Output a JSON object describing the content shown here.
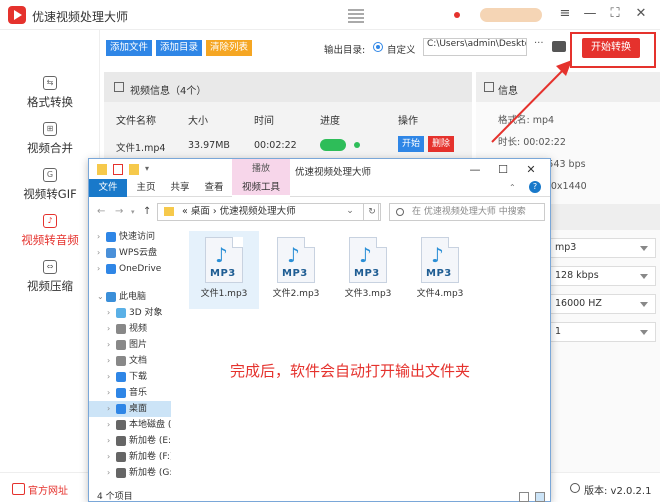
{
  "app": {
    "title": "优速视频处理大师",
    "sidebar": [
      {
        "icon": "format-icon",
        "glyph": "⇆",
        "label": "格式转换"
      },
      {
        "icon": "merge-icon",
        "glyph": "⊞",
        "label": "视频合并"
      },
      {
        "icon": "gif-icon",
        "glyph": "G",
        "label": "视频转GIF"
      },
      {
        "icon": "audio-icon",
        "glyph": "♪",
        "label": "视频转音频"
      },
      {
        "icon": "compress-icon",
        "glyph": "⇔",
        "label": "视频压缩"
      }
    ],
    "toolbar": {
      "add_file": "添加文件",
      "add_dir": "添加目录",
      "clear": "清除列表",
      "output_label": "输出目录:",
      "custom": "自定义",
      "path": "C:\\Users\\admin\\Deskto",
      "more": "···",
      "start": "开始转换"
    },
    "panel": {
      "title": "视频信息（4个）",
      "columns": [
        "文件名称",
        "大小",
        "时间",
        "进度",
        "操作"
      ],
      "row": {
        "name": "文件1.mp4",
        "size": "33.97MB",
        "time": "00:02:22",
        "start": "开始",
        "delete": "删除"
      }
    },
    "info": {
      "title": "信息",
      "lines": [
        "格式名:  mp4",
        "时长:  00:02:22",
        "码率:  2005543 bps",
        "分辨率:  2560x1440"
      ],
      "selects": [
        "mp3",
        "128 kbps",
        "16000 HZ",
        "1"
      ]
    },
    "bottom": {
      "official": "官方网址",
      "version": "版本: v2.0.2.1"
    }
  },
  "explorer": {
    "play_tab": "播放",
    "title": "优速视频处理大师",
    "ribbon": [
      "文件",
      "主页",
      "共享",
      "查看",
      "视频工具"
    ],
    "address": "«  桌面  ›  优速视频处理大师",
    "search_placeholder": "在 优速视频处理大师 中搜索",
    "tree": [
      {
        "label": "快速访问",
        "icon": "star-icon",
        "color": "#2f86e6",
        "indent": 0
      },
      {
        "label": "WPS云盘",
        "icon": "cloud-icon",
        "color": "#4a90d9",
        "indent": 0
      },
      {
        "label": "OneDrive",
        "icon": "onedrive-icon",
        "color": "#2f86e6",
        "indent": 0
      },
      {
        "label": "此电脑",
        "icon": "pc-icon",
        "color": "#3b8fd9",
        "indent": 0
      },
      {
        "label": "3D 对象",
        "icon": "cube-icon",
        "color": "#5ab0e6",
        "indent": 1
      },
      {
        "label": "视频",
        "icon": "video-icon",
        "color": "#888888",
        "indent": 1
      },
      {
        "label": "图片",
        "icon": "picture-icon",
        "color": "#888888",
        "indent": 1
      },
      {
        "label": "文档",
        "icon": "document-icon",
        "color": "#888888",
        "indent": 1
      },
      {
        "label": "下载",
        "icon": "download-icon",
        "color": "#2f86e6",
        "indent": 1
      },
      {
        "label": "音乐",
        "icon": "music-icon",
        "color": "#2f86e6",
        "indent": 1
      },
      {
        "label": "桌面",
        "icon": "desktop-icon",
        "color": "#2f86e6",
        "indent": 1,
        "selected": true
      },
      {
        "label": "本地磁盘 (C",
        "icon": "drive-icon",
        "color": "#666666",
        "indent": 1
      },
      {
        "label": "新加卷 (E:)",
        "icon": "drive-icon",
        "color": "#666666",
        "indent": 1
      },
      {
        "label": "新加卷 (F:)",
        "icon": "drive-icon",
        "color": "#666666",
        "indent": 1
      },
      {
        "label": "新加卷 (G:)",
        "icon": "drive-icon",
        "color": "#666666",
        "indent": 1
      }
    ],
    "files": [
      "文件1.mp3",
      "文件2.mp3",
      "文件3.mp3",
      "文件4.mp3"
    ],
    "file_tag": "MP3",
    "status": "4 个项目",
    "annotation": "完成后，软件会自动打开输出文件夹"
  },
  "colors": {
    "accent": "#e5322d",
    "blue": "#2f86e6",
    "orange": "#f5a623",
    "green": "#2ebd59"
  }
}
